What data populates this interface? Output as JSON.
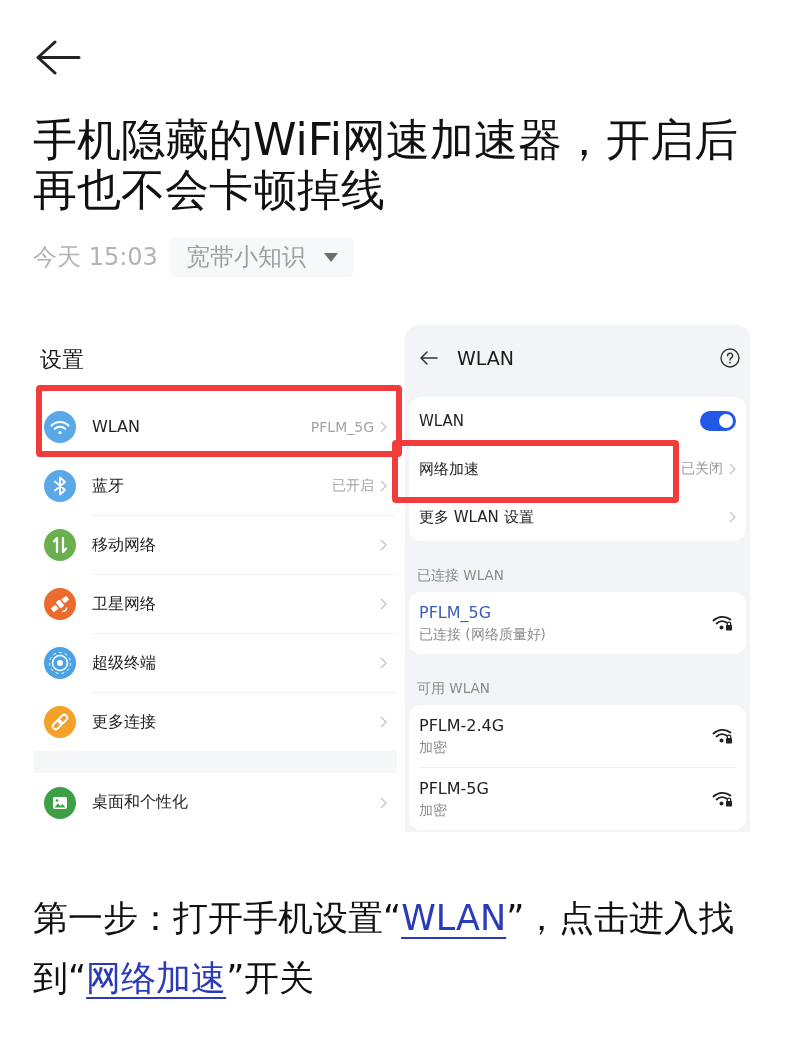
{
  "article": {
    "title": "手机隐藏的WiFi网速加速器，开启后再也不会卡顿掉线",
    "time": "今天 15:03",
    "author": "宽带小知识"
  },
  "screenshot": {
    "settings": {
      "title": "设置",
      "groups": [
        {
          "rows": [
            {
              "label": "WLAN",
              "value": "PFLM_5G",
              "color": "#5aa8e8",
              "highlighted": true
            },
            {
              "label": "蓝牙",
              "value": "已开启",
              "color": "#5aa8e8",
              "highlighted": false
            },
            {
              "label": "移动网络",
              "color": "#6bb04e",
              "highlighted": false
            },
            {
              "label": "卫星网络",
              "color": "#ec6a2c",
              "highlighted": false
            },
            {
              "label": "超级终端",
              "color": "#4ba3e4",
              "highlighted": false
            },
            {
              "label": "更多连接",
              "color": "#f4a12a",
              "highlighted": false
            }
          ]
        },
        {
          "rows": [
            {
              "label": "桌面和个性化",
              "color": "#3d9f46",
              "highlighted": false
            }
          ]
        }
      ]
    },
    "wlan": {
      "title": "WLAN",
      "settings": [
        {
          "kind": "toggle",
          "label": "WLAN",
          "on": true,
          "highlighted": false
        },
        {
          "kind": "link",
          "label": "网络加速",
          "value": "已关闭",
          "highlighted": true
        },
        {
          "kind": "link",
          "label": "更多 WLAN 设置",
          "highlighted": false
        }
      ],
      "sections": [
        {
          "label": "已连接 WLAN",
          "networks": [
            {
              "name": "PFLM_5G",
              "status": "已连接 (网络质量好)",
              "connected": true
            }
          ]
        },
        {
          "label": "可用 WLAN",
          "networks": [
            {
              "name": "PFLM-2.4G",
              "status": "加密",
              "connected": false
            },
            {
              "name": "PFLM-5G",
              "status": "加密",
              "connected": false
            }
          ]
        }
      ]
    }
  },
  "step": {
    "segments": [
      {
        "kind": "text",
        "text": "第一步：打开手机设置“"
      },
      {
        "kind": "link",
        "text": "WLAN"
      },
      {
        "kind": "text",
        "text": "”，点击进入找到“"
      },
      {
        "kind": "link",
        "text": "网络加速"
      },
      {
        "kind": "text",
        "text": "”开关"
      }
    ]
  }
}
